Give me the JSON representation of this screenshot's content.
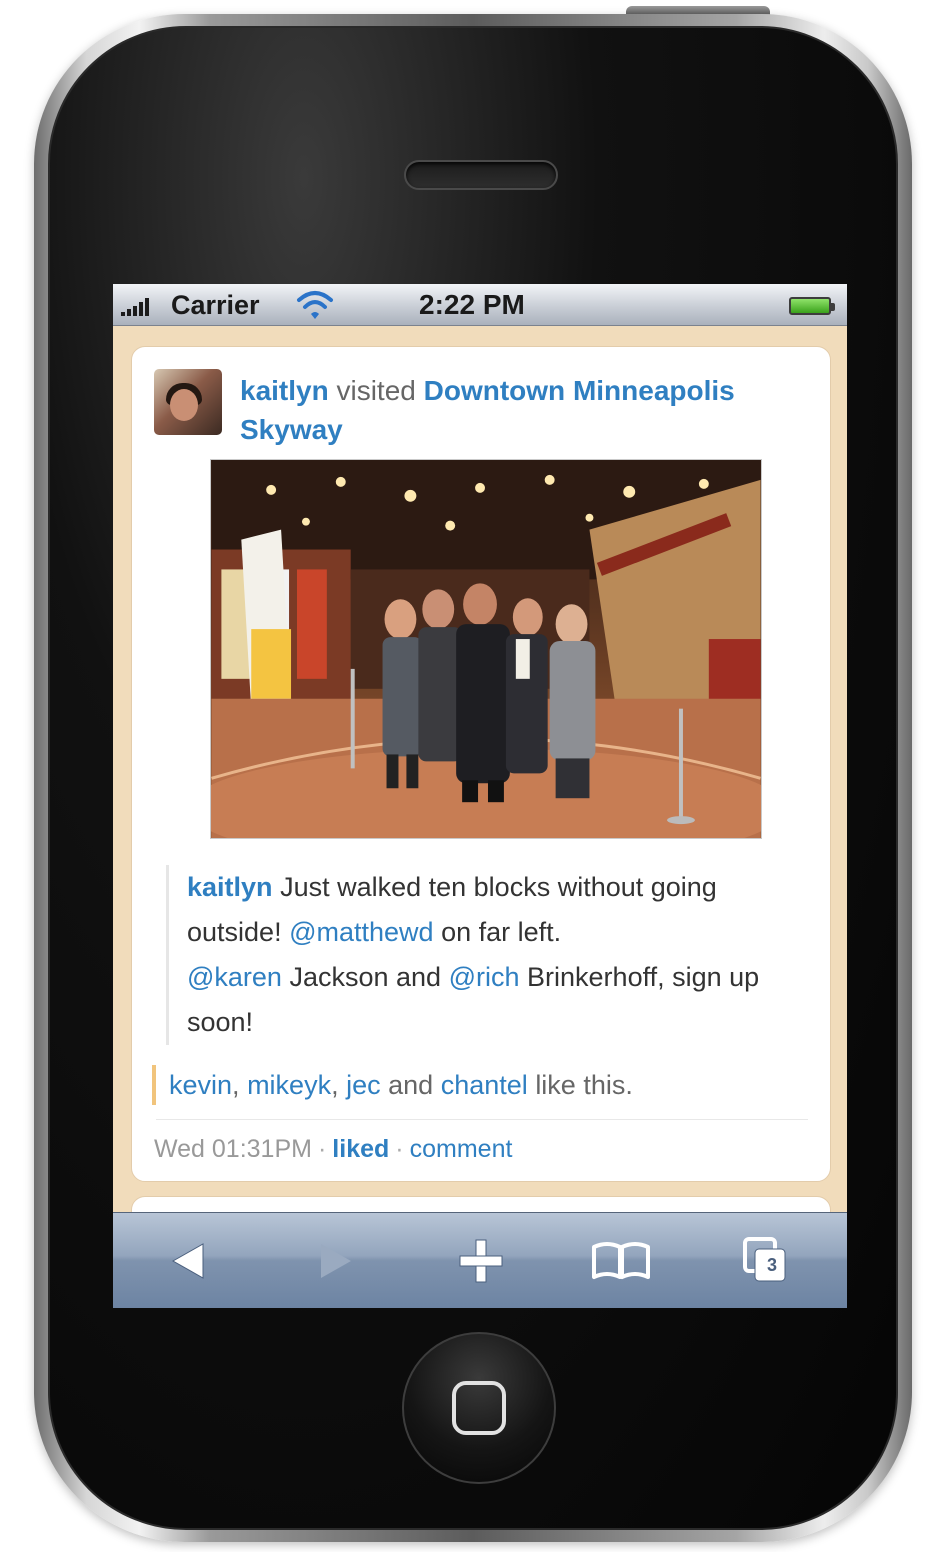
{
  "status_bar": {
    "carrier": "Carrier",
    "time": "2:22 PM",
    "signal_icon": "signal-bars-icon",
    "wifi_icon": "wifi-icon",
    "battery_icon": "battery-icon",
    "battery_level": 1.0
  },
  "post": {
    "user": "kaitlyn",
    "action": "visited",
    "place": "Downtown Minneapolis Skyway",
    "avatar_icon": "user-avatar",
    "photo_alt": "group-photo",
    "text": {
      "user": "kaitlyn",
      "part1": "Just walked ten blocks without going outside!",
      "mention1": "@matthewd",
      "part2": "on far left.",
      "mention2": "@karen",
      "part3": "Jackson and",
      "mention3": "@rich",
      "part4": "Brinkerhoff, sign up soon!"
    },
    "likes": {
      "user1": "kevin",
      "sep1": ",",
      "user2": "mikeyk",
      "sep2": ",",
      "user3": "jec",
      "and": "and",
      "user4": "chantel",
      "suffix": "like this."
    },
    "meta": {
      "timestamp": "Wed 01:31PM",
      "separator": "·",
      "liked": "liked",
      "comment": "comment"
    }
  },
  "toolbar": {
    "back_icon": "back-arrow-icon",
    "forward_icon": "forward-arrow-icon",
    "add_icon": "plus-icon",
    "bookmarks_icon": "bookmarks-book-icon",
    "pages_icon": "pages-icon",
    "pages_count": "3"
  },
  "colors": {
    "link": "#2f7fc1",
    "feed_background": "#f1dcbb",
    "likes_border": "#f1c47c",
    "toolbar": "#7f93ae"
  }
}
